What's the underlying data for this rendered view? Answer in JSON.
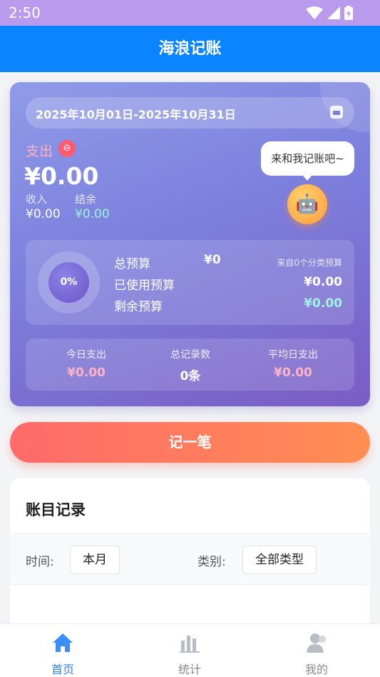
{
  "status_bar": {
    "time": "2:50"
  },
  "app": {
    "title": "海浪记账"
  },
  "summary": {
    "date_range": "2025年10月01日-2025年10月31日",
    "expense_label": "支出",
    "expense_amount": "¥0.00",
    "income_label": "收入",
    "income_value": "¥0.00",
    "balance_label": "结余",
    "balance_value": "¥0.00",
    "bubble_text": "来和我记账吧~",
    "budget": {
      "progress_text": "0%",
      "progress": 0,
      "total_label": "总预算",
      "total_value": "¥0",
      "source_note": "来自0个分类预算",
      "used_label": "已使用预算",
      "used_value": "¥0.00",
      "remaining_label": "剩余预算",
      "remaining_value": "¥0.00"
    },
    "stats": [
      {
        "label": "今日支出",
        "value": "¥0.00",
        "color": "#ffb3c7"
      },
      {
        "label": "总记录数",
        "value": "0条",
        "color": "#ffffff"
      },
      {
        "label": "平均日支出",
        "value": "¥0.00",
        "color": "#ffb3c7"
      }
    ]
  },
  "record_button": {
    "label": "记一笔"
  },
  "records": {
    "title": "账目记录",
    "time_label": "时间:",
    "time_value": "本月",
    "category_label": "类别:",
    "category_value": "全部类型"
  },
  "tabs": [
    {
      "label": "首页",
      "icon": "home-icon",
      "active": true
    },
    {
      "label": "统计",
      "icon": "chart-icon",
      "active": false
    },
    {
      "label": "我的",
      "icon": "user-icon",
      "active": false
    }
  ],
  "colors": {
    "primary": "#0a84ff",
    "accent": "#ff7a5a",
    "card_start": "#8f9be8",
    "card_end": "#7a5cc4"
  }
}
